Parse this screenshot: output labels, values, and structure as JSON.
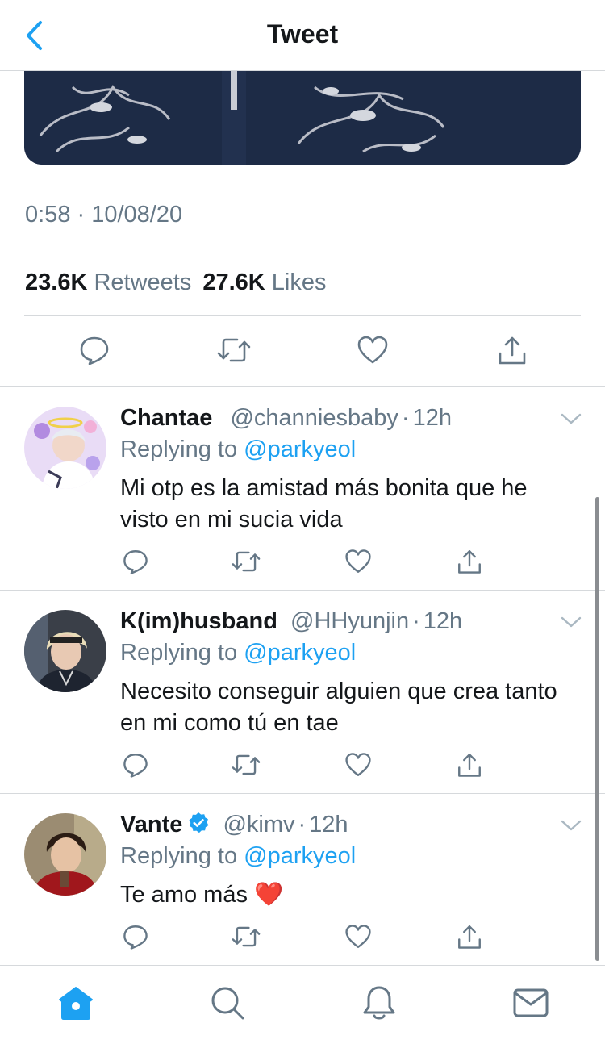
{
  "header": {
    "title": "Tweet"
  },
  "tweet": {
    "timestamp": "0:58 · 10/08/20",
    "retweets_count": "23.6K",
    "retweets_label": "Retweets",
    "likes_count": "27.6K",
    "likes_label": "Likes"
  },
  "replies": [
    {
      "name": "Chantae",
      "handle": "@channiesbaby",
      "time": "12h",
      "replying_label": "Replying to",
      "replying_to": "@parkyeol",
      "text": "Mi otp es la amistad más bonita que he visto en mi sucia vida"
    },
    {
      "name": "K(im)husband",
      "handle": "@HHyunjin",
      "time": "12h",
      "replying_label": "Replying to",
      "replying_to": "@parkyeol",
      "text": "Necesito conseguir alguien que crea tanto en mi como tú en tae"
    },
    {
      "name": "Vante",
      "handle": "@kimv",
      "time": "12h",
      "verified": true,
      "replying_label": "Replying to",
      "replying_to": "@parkyeol",
      "text": "Te amo más",
      "emoji": "❤️"
    }
  ],
  "tabs": [
    "home-icon",
    "search-icon",
    "notifications-icon",
    "messages-icon"
  ],
  "colors": {
    "accent": "#1da1f2",
    "secondary_text": "#657786",
    "primary_text": "#14171a",
    "divider": "#d6d9dc"
  }
}
